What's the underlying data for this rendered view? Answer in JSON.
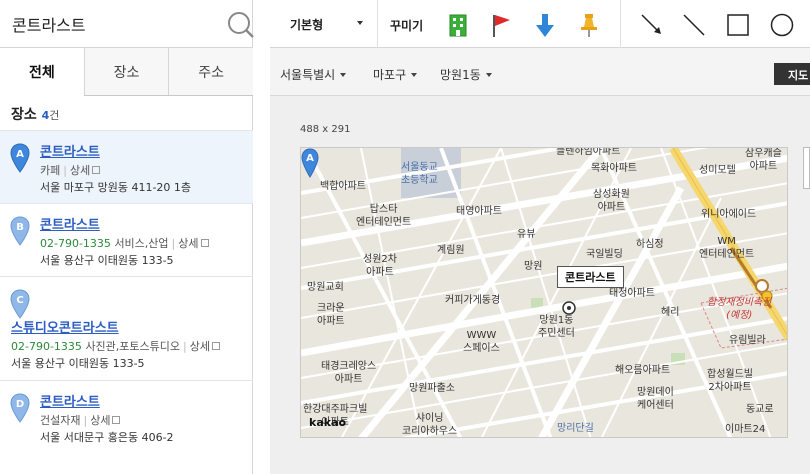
{
  "search": {
    "value": "콘트라스트",
    "placeholder": ""
  },
  "tabs": [
    {
      "label": "전체",
      "active": true
    },
    {
      "label": "장소",
      "active": false
    },
    {
      "label": "주소",
      "active": false
    }
  ],
  "results": {
    "heading": "장소",
    "count": "4",
    "unit": "건"
  },
  "places": [
    {
      "marker": "A",
      "name": "콘트라스트",
      "category": "카페",
      "detail": "상세",
      "phone": "",
      "address": "서울 마포구 망원동 411-20 1층"
    },
    {
      "marker": "B",
      "name": "콘트라스트",
      "phone": "02-790-1335",
      "category": "서비스,산업",
      "detail": "상세",
      "address": "서울 용산구 이태원동 133-5"
    },
    {
      "marker": "C",
      "name": "스튜디오콘트라스트",
      "phone": "02-790-1335",
      "category": "사진관,포토스튜디오",
      "detail": "상세",
      "address": "서울 용산구 이태원동 133-5"
    },
    {
      "marker": "D",
      "name": "콘트라스트",
      "category": "건설자재",
      "detail": "상세",
      "phone": "",
      "address": "서울 서대문구 홍은동 406-2"
    }
  ],
  "toolbar": {
    "style_select": "기본형",
    "decorate_label": "꾸미기",
    "icons": [
      "building-icon",
      "flag-icon",
      "down-arrow-icon",
      "pushpin-icon",
      "arrow-line-icon",
      "line-icon",
      "rectangle-icon",
      "circle-icon"
    ]
  },
  "filters": {
    "city": "서울특별시",
    "district": "마포구",
    "dong": "망원1동",
    "map_button": "지도"
  },
  "map": {
    "size_label": "488 x 291",
    "callout": "콘트라스트",
    "callout_marker": "A",
    "logo": "kakao",
    "labels": [
      {
        "text": "플렌하임아파트",
        "cls": ""
      },
      {
        "text": "삼우캐슬\n아파트",
        "cls": ""
      },
      {
        "text": "서울동교\n초등학교",
        "cls": "blue"
      },
      {
        "text": "목화아파트",
        "cls": ""
      },
      {
        "text": "성미모텔",
        "cls": ""
      },
      {
        "text": "백합아파트",
        "cls": ""
      },
      {
        "text": "삼성화원\n아파트",
        "cls": ""
      },
      {
        "text": "탑스타\n엔터테인먼트",
        "cls": ""
      },
      {
        "text": "태영아파트",
        "cls": ""
      },
      {
        "text": "위니아에이드",
        "cls": ""
      },
      {
        "text": "유뷰",
        "cls": ""
      },
      {
        "text": "하심정",
        "cls": ""
      },
      {
        "text": "WM\n엔터테인먼트",
        "cls": ""
      },
      {
        "text": "계림원",
        "cls": ""
      },
      {
        "text": "국일빌딩",
        "cls": ""
      },
      {
        "text": "성원2차\n아파트",
        "cls": ""
      },
      {
        "text": "망원",
        "cls": ""
      },
      {
        "text": "태청아파트",
        "cls": ""
      },
      {
        "text": "망원교회",
        "cls": ""
      },
      {
        "text": "합정재정비촉진\n(예정)",
        "cls": "red"
      },
      {
        "text": "커피가게동경",
        "cls": ""
      },
      {
        "text": "헤리",
        "cls": ""
      },
      {
        "text": "크라운\n아파트",
        "cls": ""
      },
      {
        "text": "망원1동\n주민센터",
        "cls": ""
      },
      {
        "text": "유림빌라",
        "cls": ""
      },
      {
        "text": "WWW\n스페이스",
        "cls": ""
      },
      {
        "text": "태경크레앙스\n아파트",
        "cls": ""
      },
      {
        "text": "해오름아파트",
        "cls": ""
      },
      {
        "text": "합성월드빌\n2차아파트",
        "cls": ""
      },
      {
        "text": "망원파출소",
        "cls": ""
      },
      {
        "text": "망원데이\n케어센터",
        "cls": ""
      },
      {
        "text": "한강대주파크빌\n아파트",
        "cls": ""
      },
      {
        "text": "샤이닝\n코리아하우스",
        "cls": ""
      },
      {
        "text": "망리단길",
        "cls": "blue"
      },
      {
        "text": "이마트24",
        "cls": ""
      },
      {
        "text": "동교로",
        "cls": ""
      }
    ]
  },
  "colors": {
    "link_blue": "#2a5cc4",
    "phone_green": "#2c8a3a",
    "marker_blue": "#4a90e2",
    "selected_bg": "#eef4fb"
  }
}
